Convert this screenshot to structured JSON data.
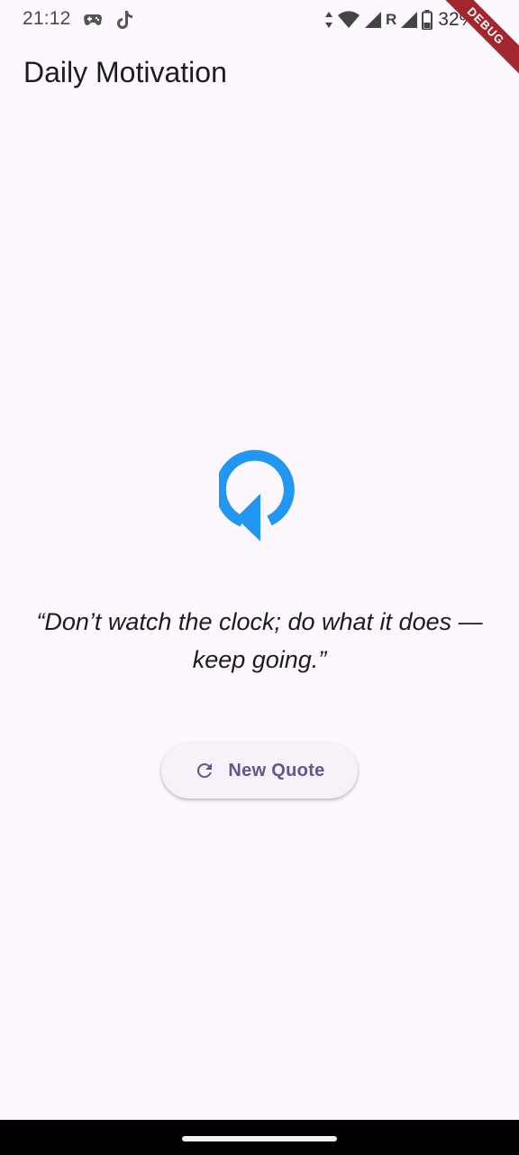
{
  "status_bar": {
    "time": "21:12",
    "battery": "32%",
    "network_letter": "R",
    "left_icons": [
      "gamepad-icon",
      "tiktok-icon"
    ],
    "right_icons": [
      "data-arrows-icon",
      "wifi-icon",
      "signal-icon",
      "roaming-indicator",
      "signal-icon",
      "battery-icon"
    ]
  },
  "debug_banner": "DEBUG",
  "app_bar": {
    "title": "Daily Motivation"
  },
  "hero": {
    "icon": "refresh-arrow-icon",
    "color": "#2196f3"
  },
  "quote": {
    "text": "“Don’t watch the clock; do what it does — keep going.”"
  },
  "new_quote_button": {
    "label": "New Quote",
    "icon": "refresh-icon",
    "color": "#65558f"
  },
  "colors": {
    "background": "#fdf7fe",
    "accent": "#2196f3",
    "button_text": "#65558f",
    "debug_banner": "#a3262e"
  }
}
